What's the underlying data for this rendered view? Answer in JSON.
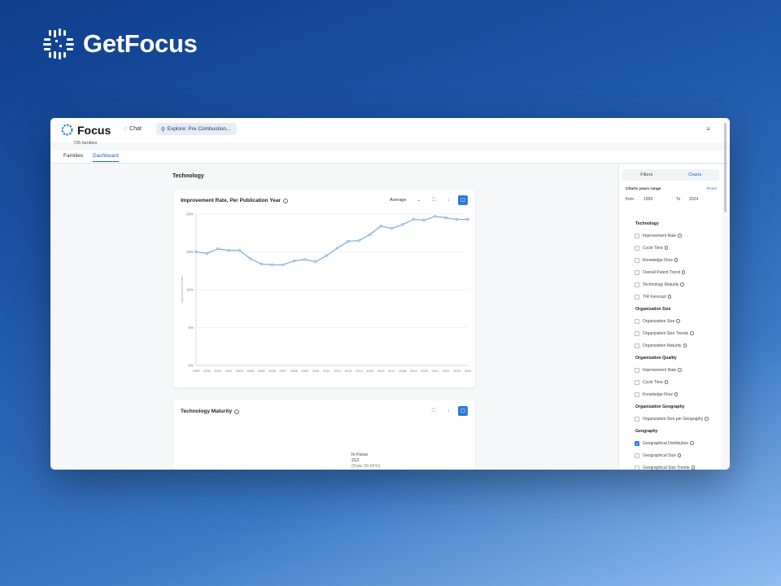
{
  "brand": {
    "name": "GetFocus"
  },
  "app": {
    "logo_text": "Focus",
    "chat_label": "Chat",
    "explore_label": "Explore: Pre Combustion...",
    "families_count": "735 families",
    "tabs": [
      {
        "label": "Families"
      },
      {
        "label": "Dashboard"
      }
    ]
  },
  "main": {
    "section_title": "Technology",
    "improvement_card": {
      "title": "Improvement Rate, Per Publication Year",
      "aggregate": "Average"
    },
    "maturity_card": {
      "title": "Technology Maturity",
      "label": "In Force",
      "value": "212",
      "sublabel": "(Rate 28.84%)"
    }
  },
  "sidebar": {
    "tabs": [
      {
        "label": "Filters"
      },
      {
        "label": "Charts"
      }
    ],
    "range_label": "Charts years range",
    "reset_label": "Reset",
    "from_label": "from",
    "from_value": "1999",
    "to_label": "To",
    "to_value": "2024",
    "filters": [
      {
        "kind": "group",
        "label": "Technology"
      },
      {
        "kind": "item",
        "label": "Improvement Rate",
        "checked": false
      },
      {
        "kind": "item",
        "label": "Cycle Time",
        "checked": false
      },
      {
        "kind": "item",
        "label": "Knowledge Flow",
        "checked": false
      },
      {
        "kind": "item",
        "label": "Overall Patent Trend",
        "checked": false
      },
      {
        "kind": "item",
        "label": "Technology Maturity",
        "checked": false
      },
      {
        "kind": "item",
        "label": "TIR Forecast",
        "checked": false
      },
      {
        "kind": "group",
        "label": "Organization Size"
      },
      {
        "kind": "item",
        "label": "Organization Size",
        "checked": false
      },
      {
        "kind": "item",
        "label": "Organization Size Trends",
        "checked": false
      },
      {
        "kind": "item",
        "label": "Organization Maturity",
        "checked": false
      },
      {
        "kind": "group",
        "label": "Organization Quality"
      },
      {
        "kind": "item",
        "label": "Improvement Rate",
        "checked": false
      },
      {
        "kind": "item",
        "label": "Cycle Time",
        "checked": false
      },
      {
        "kind": "item",
        "label": "Knowledge Flow",
        "checked": false
      },
      {
        "kind": "group",
        "label": "Organization Geography"
      },
      {
        "kind": "item",
        "label": "Organization Size per Geography",
        "checked": false
      },
      {
        "kind": "group",
        "label": "Geography"
      },
      {
        "kind": "item",
        "label": "Geographical Distribution",
        "checked": true
      },
      {
        "kind": "item",
        "label": "Geographical Size",
        "checked": false
      },
      {
        "kind": "item",
        "label": "Geographical Size Trends",
        "checked": false
      }
    ]
  },
  "colors": {
    "accent": "#2f7ad8",
    "line": "#6fa6d8",
    "donut": "#2e9e4a"
  },
  "chart_data": {
    "type": "line",
    "title": "Improvement Rate, Per Publication Year",
    "ylabel": "Improvement Rate",
    "x": [
      1999,
      2000,
      2001,
      2002,
      2003,
      2004,
      2005,
      2006,
      2007,
      2008,
      2009,
      2010,
      2011,
      2012,
      2013,
      2014,
      2015,
      2016,
      2017,
      2018,
      2019,
      2020,
      2021,
      2022,
      2023,
      2024
    ],
    "values": [
      15.0,
      14.8,
      15.4,
      15.2,
      15.2,
      14.1,
      13.4,
      13.3,
      13.3,
      13.8,
      14.0,
      13.7,
      14.5,
      15.5,
      16.4,
      16.5,
      17.3,
      18.4,
      18.1,
      18.6,
      19.3,
      19.2,
      19.7,
      19.5,
      19.3,
      19.3
    ],
    "yticks": [
      "0%",
      "5%",
      "10%",
      "15%",
      "20%"
    ],
    "ylim": [
      0,
      20
    ],
    "grid": true
  }
}
